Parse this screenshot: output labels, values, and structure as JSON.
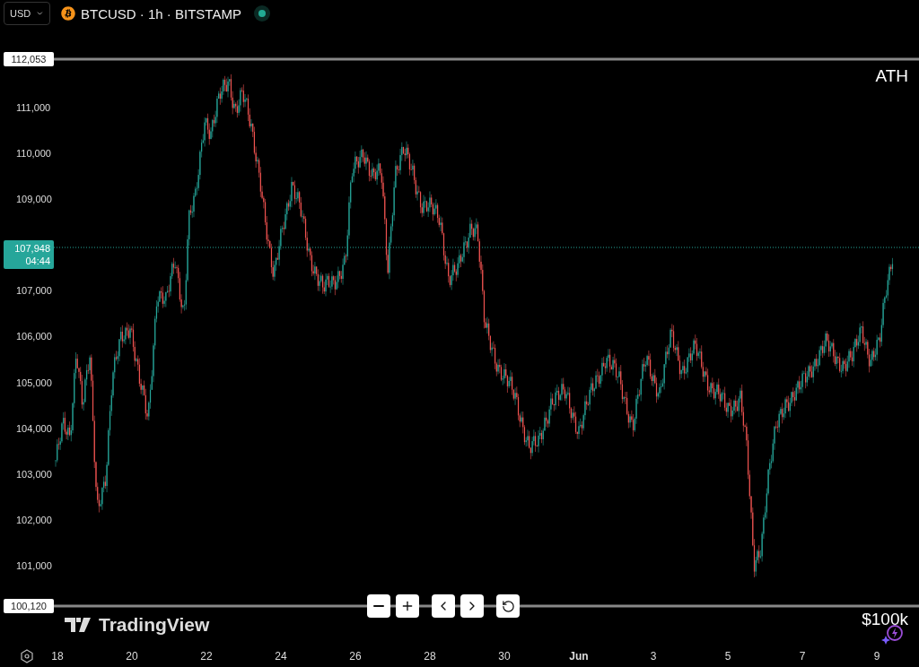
{
  "header": {
    "currency_select": {
      "value": "USD"
    },
    "symbol_title": "BTCUSD · 1h · BITSTAMP",
    "market_open": true
  },
  "price_axis": {
    "ticks": [
      "111,000",
      "110,000",
      "109,000",
      "107,000",
      "106,000",
      "105,000",
      "104,000",
      "103,000",
      "102,000",
      "101,000"
    ]
  },
  "price_lines": [
    {
      "label": "112,053",
      "note": "ATH"
    },
    {
      "label": "100,120",
      "note": "$100k"
    }
  ],
  "current_price": {
    "price": "107,948",
    "countdown": "04:44"
  },
  "watermark_logo": "TradingView",
  "time_axis": {
    "labels": [
      "18",
      "20",
      "22",
      "24",
      "26",
      "28",
      "30",
      "Jun",
      "3",
      "5",
      "7",
      "9"
    ]
  }
}
